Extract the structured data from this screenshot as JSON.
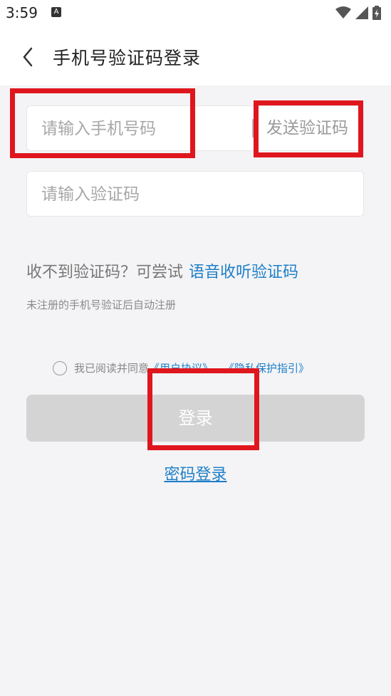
{
  "status_bar": {
    "time": "3:59",
    "notification_icon": "A",
    "icons": [
      "wifi-icon",
      "signal-icon",
      "battery-icon"
    ]
  },
  "header": {
    "title": "手机号验证码登录",
    "back_icon": "chevron-left-icon"
  },
  "form": {
    "phone_placeholder": "请输入手机号码",
    "send_code_label": "发送验证码",
    "code_placeholder": "请输入验证码"
  },
  "help": {
    "no_code_text": "收不到验证码？可尝试",
    "voice_link": "语音收听验证码",
    "auto_register": "未注册的手机号验证后自动注册"
  },
  "agreement": {
    "prefix": "我已阅读并同意",
    "user_agreement": "《用户协议》",
    "separator": "、",
    "privacy": "《隐私保护指引》"
  },
  "buttons": {
    "login": "登录",
    "password_login": "密码登录"
  },
  "colors": {
    "accent_link": "#1e7fc8",
    "highlight_box": "#e0161e",
    "disabled_button": "#d4d4d4"
  }
}
